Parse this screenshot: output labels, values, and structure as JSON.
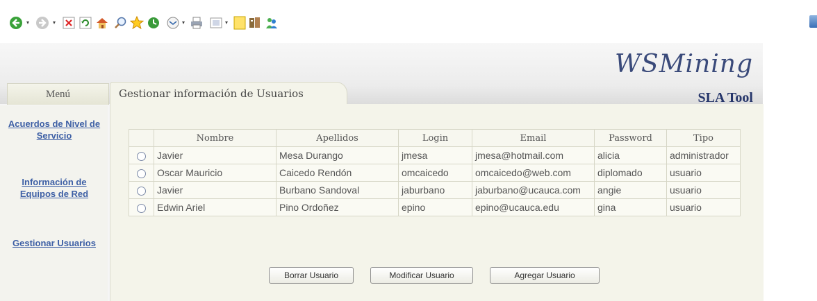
{
  "toolbar": {
    "icons": [
      "back-icon",
      "forward-icon",
      "stop-icon",
      "refresh-icon",
      "home-icon",
      "search-icon",
      "favorites-icon",
      "history-icon",
      "mail-icon",
      "print-icon",
      "edit-icon",
      "notes-icon",
      "research-icon",
      "messenger-icon"
    ]
  },
  "brand": {
    "title": "WSMining",
    "subtitle": "SLA Tool"
  },
  "sidebar": {
    "tab_label": "Menú",
    "items": [
      {
        "label": "Acuerdos de Nivel de Servicio"
      },
      {
        "label": "Información de Equipos de Red"
      },
      {
        "label": "Gestionar Usuarios"
      }
    ]
  },
  "main": {
    "tab_label": "Gestionar información de Usuarios"
  },
  "table": {
    "headers": [
      "Nombre",
      "Apellidos",
      "Login",
      "Email",
      "Password",
      "Tipo"
    ],
    "rows": [
      {
        "nombre": "Javier",
        "apellidos": "Mesa Durango",
        "login": "jmesa",
        "email": "jmesa@hotmail.com",
        "password": "alicia",
        "tipo": "administrador"
      },
      {
        "nombre": "Oscar Mauricio",
        "apellidos": "Caicedo Rendón",
        "login": "omcaicedo",
        "email": "omcaicedo@web.com",
        "password": "diplomado",
        "tipo": "usuario"
      },
      {
        "nombre": "Javier",
        "apellidos": "Burbano Sandoval",
        "login": "jaburbano",
        "email": "jaburbano@ucauca.com",
        "password": "angie",
        "tipo": "usuario"
      },
      {
        "nombre": "Edwin Ariel",
        "apellidos": "Pino Ordoñez",
        "login": "epino",
        "email": "epino@ucauca.edu",
        "password": "gina",
        "tipo": "usuario"
      }
    ]
  },
  "buttons": {
    "delete": "Borrar Usuario",
    "modify": "Modificar Usuario",
    "add": "Agregar Usuario"
  }
}
